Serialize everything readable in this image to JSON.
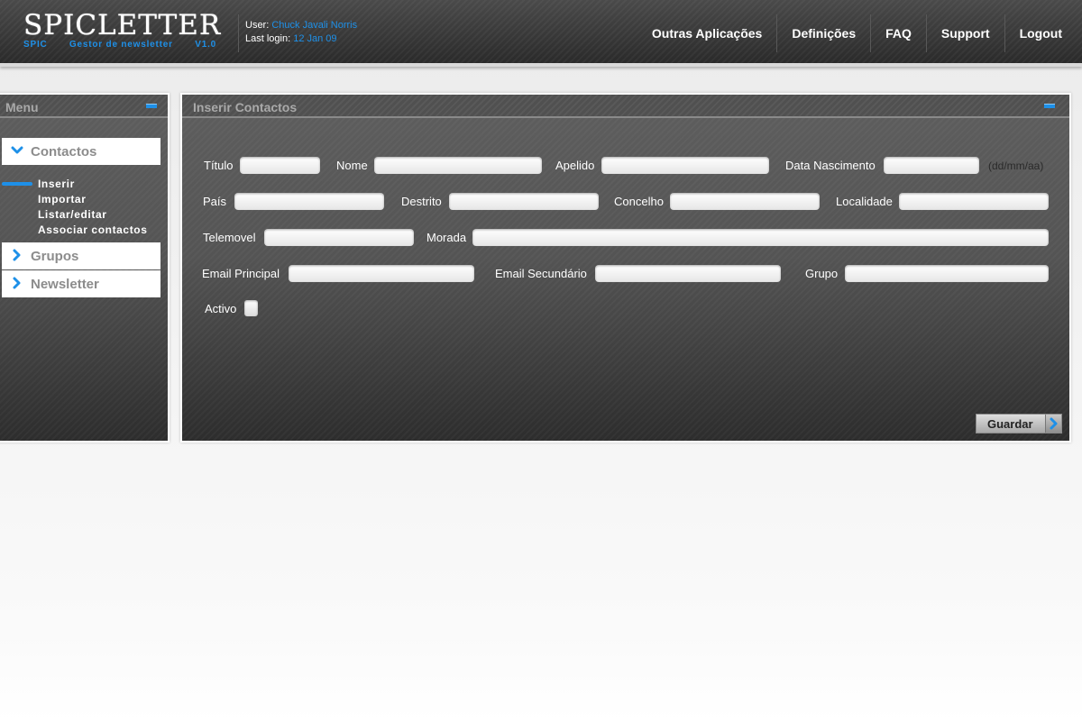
{
  "app": {
    "logo_title": "SPICLETTER",
    "logo_sub_left": "SPIC",
    "logo_sub_mid": "Gestor de newsletter",
    "logo_sub_right": "V1.0"
  },
  "user": {
    "user_label": "User:",
    "user_name": "Chuck Javali Norris",
    "last_login_label": "Last login:",
    "last_login_date": "12 Jan 09"
  },
  "topnav": [
    "Outras Aplicações",
    "Definições",
    "FAQ",
    "Support",
    "Logout"
  ],
  "sidebar": {
    "title": "Menu",
    "sections": [
      {
        "label": "Contactos",
        "expanded": true
      },
      {
        "label": "Grupos",
        "expanded": false
      },
      {
        "label": "Newsletter",
        "expanded": false
      }
    ],
    "subitems": [
      "Inserir",
      "Importar",
      "Listar/editar",
      "Associar contactos"
    ],
    "active_subitem": "Inserir"
  },
  "main": {
    "title": "Inserir Contactos",
    "fields": {
      "titulo": "Título",
      "nome": "Nome",
      "apelido": "Apelido",
      "data_nascimento": "Data Nascimento",
      "date_hint": "(dd/mm/aa)",
      "pais": "País",
      "destrito": "Destrito",
      "concelho": "Concelho",
      "localidade": "Localidade",
      "telemovel": "Telemovel",
      "morada": "Morada",
      "email_principal": "Email Principal",
      "email_secundario": "Email Secundário",
      "grupo": "Grupo",
      "activo": "Activo"
    },
    "save_label": "Guardar"
  },
  "colors": {
    "accent": "#1e90e8",
    "panel_dark": "#2f2f2f",
    "panel_light": "#5e5e5e"
  }
}
